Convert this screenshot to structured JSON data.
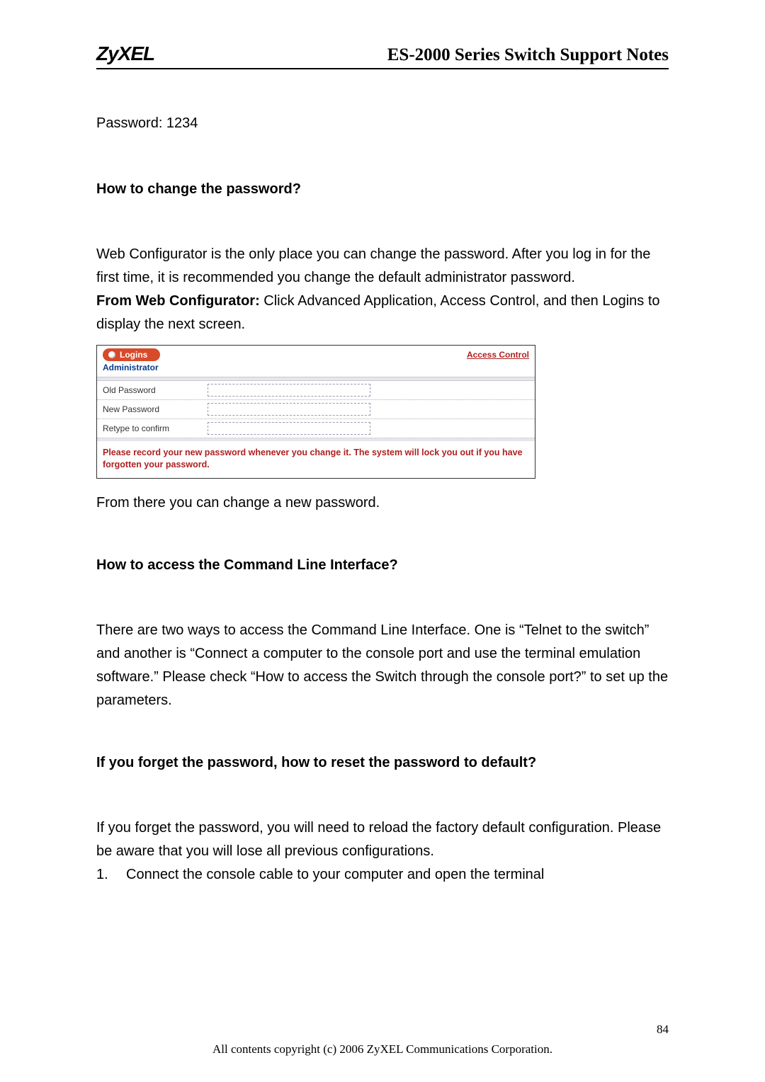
{
  "header": {
    "logo": "ZyXEL",
    "doc_title": "ES-2000 Series Switch Support Notes"
  },
  "password_line": "Password: 1234",
  "sections": {
    "change_pw": {
      "heading": "How to change the password?",
      "para1": "Web Configurator is the only place you can change the password. After you log in for the first time, it is recommended you change the default administrator password.",
      "from_label": "From Web Configurator:",
      "from_rest": " Click Advanced Application, Access Control, and then Logins to display the next screen.",
      "after_panel": "From there you can change a new password."
    },
    "cli": {
      "heading": "How to access the Command Line Interface?",
      "para": "There are two ways to access the Command Line Interface. One is “Telnet to the switch” and another is “Connect a computer to the console port and use the terminal emulation software.” Please check “How to access the Switch through the console port?” to set up the parameters."
    },
    "reset": {
      "heading": "If you forget the password, how to reset the password to default?",
      "para": "If you forget the password, you will need to reload the factory default configuration. Please be aware that you will lose all previous configurations.",
      "step1_num": "1.",
      "step1": "Connect the console cable to your computer and open the terminal"
    }
  },
  "panel": {
    "tab_label": "Logins",
    "access_link": "Access Control",
    "administrator": "Administrator",
    "fields": {
      "old": "Old Password",
      "new": "New Password",
      "retype": "Retype to confirm"
    },
    "warning": "Please record your new password whenever you change it. The system will lock you out if you have forgotten your password."
  },
  "footer": {
    "page_number": "84",
    "copyright": "All contents copyright (c) 2006 ZyXEL Communications Corporation."
  }
}
